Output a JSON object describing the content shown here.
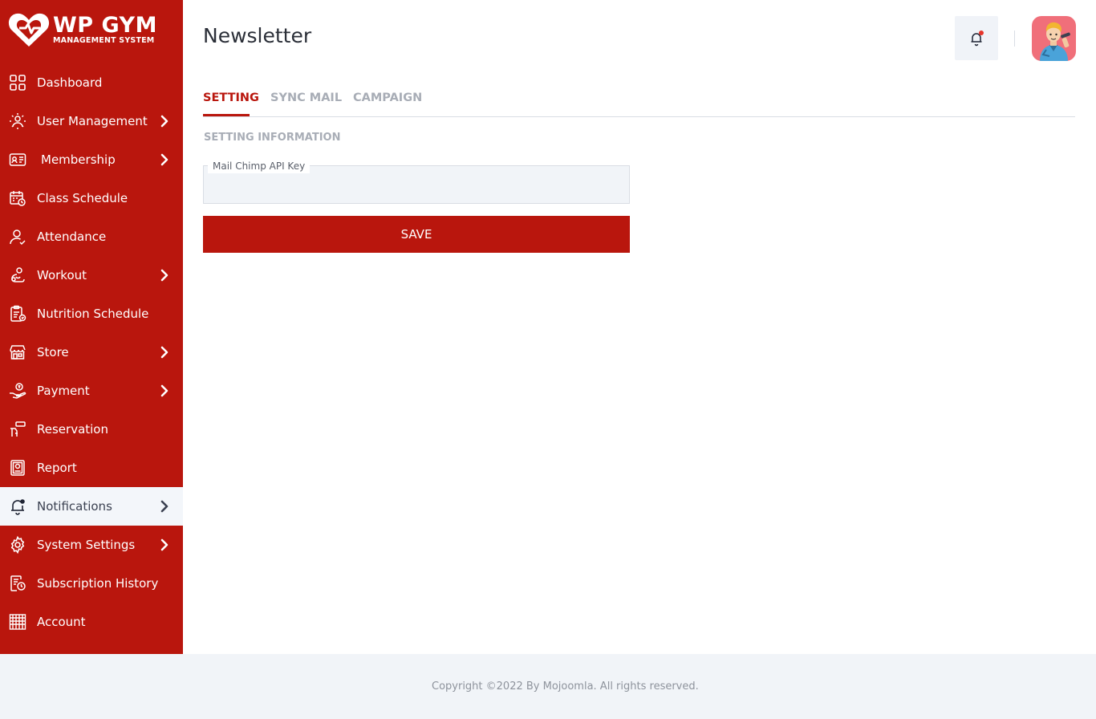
{
  "brand": {
    "title": "WP GYM",
    "subtitle": "MANAGEMENT SYSTEM",
    "accent_color": "#b9160d"
  },
  "sidebar": {
    "items": [
      {
        "label": "Dashboard",
        "icon": "dashboard-icon",
        "has_submenu": false
      },
      {
        "label": "User Management",
        "icon": "users-gear-icon",
        "has_submenu": true
      },
      {
        "label": "Membership",
        "icon": "membership-card-icon",
        "has_submenu": true
      },
      {
        "label": "Class Schedule",
        "icon": "calendar-icon",
        "has_submenu": false
      },
      {
        "label": "Attendance",
        "icon": "user-check-icon",
        "has_submenu": false
      },
      {
        "label": "Workout",
        "icon": "workout-icon",
        "has_submenu": true
      },
      {
        "label": "Nutrition Schedule",
        "icon": "clipboard-icon",
        "has_submenu": false
      },
      {
        "label": "Store",
        "icon": "store-icon",
        "has_submenu": true
      },
      {
        "label": "Payment",
        "icon": "payment-hand-icon",
        "has_submenu": true
      },
      {
        "label": "Reservation",
        "icon": "reservation-icon",
        "has_submenu": false
      },
      {
        "label": "Report",
        "icon": "report-icon",
        "has_submenu": false
      },
      {
        "label": "Notifications",
        "icon": "bell-icon",
        "has_submenu": true,
        "active": true
      },
      {
        "label": "System Settings",
        "icon": "gear-icon",
        "has_submenu": true
      },
      {
        "label": "Subscription History",
        "icon": "history-icon",
        "has_submenu": false
      },
      {
        "label": "Account",
        "icon": "account-icon",
        "has_submenu": false
      }
    ]
  },
  "header": {
    "title": "Newsletter",
    "notification_icon": "bell-icon",
    "avatar_icon": "user-avatar-icon"
  },
  "tabs": [
    {
      "label": "SETTING",
      "active": true
    },
    {
      "label": "SYNC MAIL",
      "active": false
    },
    {
      "label": "CAMPAIGN",
      "active": false
    }
  ],
  "form": {
    "section_title": "SETTING INFORMATION",
    "api_key_label": "Mail Chimp API Key",
    "api_key_value": "",
    "save_label": "SAVE"
  },
  "footer": {
    "copyright": "Copyright ©2022 By Mojoomla. All rights reserved."
  }
}
